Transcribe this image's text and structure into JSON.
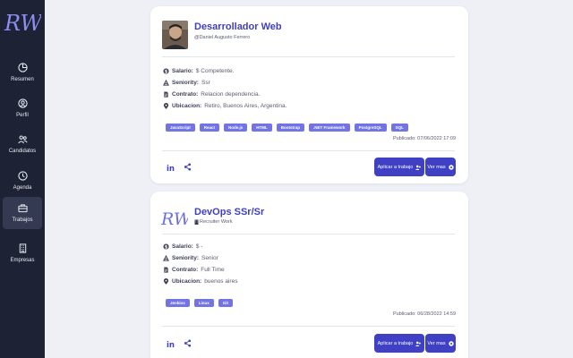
{
  "sidebar": {
    "logo": "RW",
    "items": [
      {
        "label": "Resumen",
        "icon": "pie-chart-icon"
      },
      {
        "label": "Perfil",
        "icon": "user-circle-icon"
      },
      {
        "label": "Candidatos",
        "icon": "users-icon"
      },
      {
        "label": "Agenda",
        "icon": "clock-icon"
      },
      {
        "label": "Trabajos",
        "icon": "briefcase-icon",
        "active": true
      },
      {
        "label": "Empresas",
        "icon": "building-icon"
      }
    ]
  },
  "colors": {
    "accent": "#3f40c4",
    "tag": "#7274e6",
    "sidebar": "#1e2235",
    "title": "#3f3fbf"
  },
  "jobs": [
    {
      "title": "Desarrollador Web",
      "company": "@Daniel Augusto Ferrero",
      "salario_label": "Salario:",
      "salario": "$ Competente.",
      "seniority_label": "Seniority:",
      "seniority": "Ssr",
      "contrato_label": "Contrato:",
      "contrato": "Relacion dependencia.",
      "ubicacion_label": "Ubicacion:",
      "ubicacion": "Retiro, Buenos Aires, Argentina.",
      "tags": [
        "JavaScript",
        "React",
        "Node.js",
        "HTML",
        "Bootstrap",
        ".NET Framework",
        "PostgreSQL",
        "SQL"
      ],
      "published": "Publicado: 07/06/2022 17:09",
      "apply_label": "Aplicar a trabajo",
      "more_label": "Ver mas"
    },
    {
      "title": "DevOps SSr/Sr",
      "company": "Recruiter Work",
      "logo_text": "RW",
      "salario_label": "Salario:",
      "salario": "$ -",
      "seniority_label": "Seniority:",
      "seniority": "Senior",
      "contrato_label": "Contrato:",
      "contrato": "Full Time",
      "ubicacion_label": "Ubicacion:",
      "ubicacion": "buenos aires",
      "tags": [
        "Jenkins",
        "Linux",
        "Git"
      ],
      "published": "Publicado: 06/28/2022 14:59",
      "apply_label": "Aplicar a trabajo",
      "more_label": "Ver mas"
    }
  ]
}
